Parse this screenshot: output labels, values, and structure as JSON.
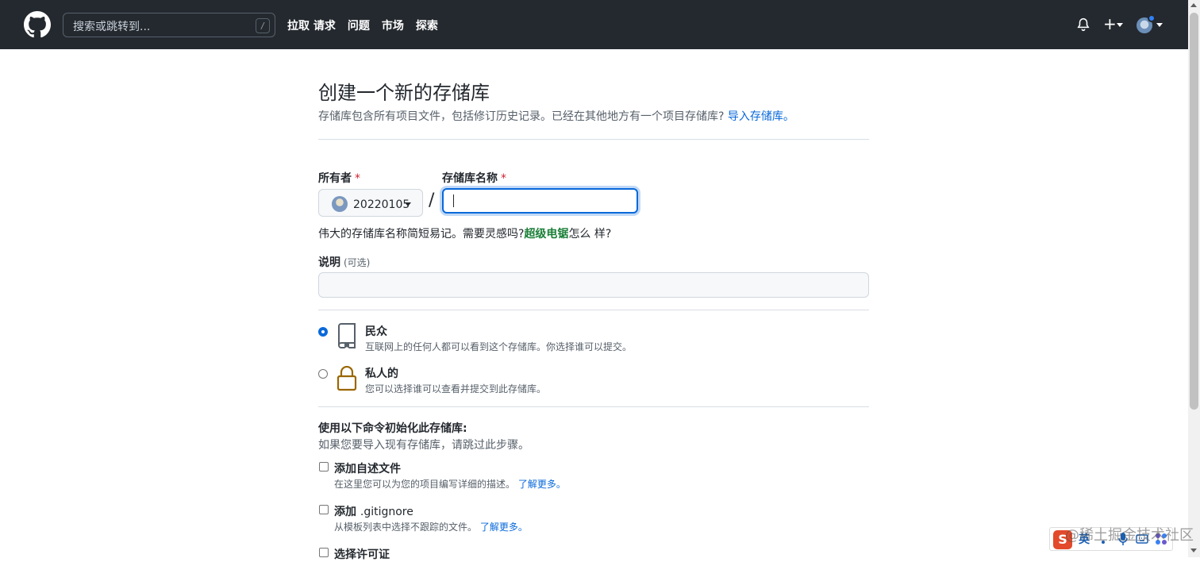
{
  "header": {
    "search_placeholder": "搜索或跳转到...",
    "search_key": "/",
    "nav": [
      "拉取 请求",
      "问题",
      "市场",
      "探索"
    ],
    "plus": "+"
  },
  "page": {
    "title": "创建一个新的存储库",
    "subtitle": "存储库包含所有项目文件，包括修订历史记录。已经在其他地方有一个项目存储库?",
    "import_link": "导入存储库。"
  },
  "owner": {
    "label": "所有者",
    "required": "*",
    "value": "20220105"
  },
  "repo_name": {
    "label": "存储库名称",
    "required": "*",
    "separator": "/",
    "value": ""
  },
  "hint": {
    "prefix": "伟大的存储库名称简短易记。需要灵感吗?",
    "suggestion": "超级电锯",
    "suffix": "怎么 样?"
  },
  "description": {
    "label": "说明",
    "optional": "(可选)",
    "value": ""
  },
  "visibility": {
    "public": {
      "title": "民众",
      "desc": "互联网上的任何人都可以看到这个存储库。你选择谁可以提交。",
      "checked": true
    },
    "private": {
      "title": "私人的",
      "desc": "您可以选择谁可以查看并提交到此存储库。",
      "checked": false
    }
  },
  "init": {
    "heading": "使用以下命令初始化此存储库:",
    "sub": "如果您要导入现有存储库，请跳过此步骤。",
    "readme": {
      "title": "添加自述文件",
      "desc": "在这里您可以为您的项目编写详细的描述。",
      "link": "了解更多。"
    },
    "gitignore": {
      "title_prefix": "添加",
      "title_code": ".gitignore",
      "desc": "从模板列表中选择不跟踪的文件。",
      "link": "了解更多。"
    },
    "license": {
      "title": "选择许可证"
    }
  },
  "overlay": {
    "watermark": "@稀土掘金技术社区",
    "ime_logo": "S",
    "ime_lang": "英"
  },
  "colors": {
    "header_bg": "#24292f",
    "link": "#0969da",
    "required": "#cf222e",
    "suggestion": "#1a7f37",
    "lock_icon": "#9a6700"
  }
}
